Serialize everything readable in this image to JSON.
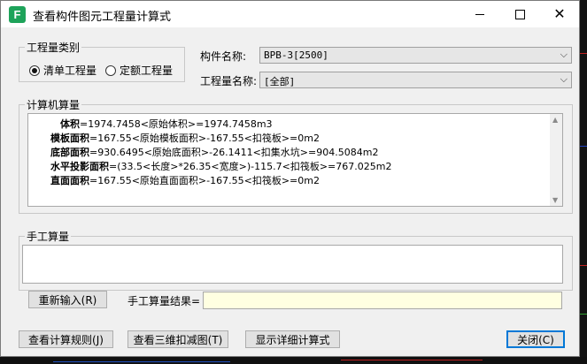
{
  "window": {
    "title": "查看构件图元工程量计算式"
  },
  "quantity_type": {
    "legend": "工程量类别",
    "options": [
      {
        "label": "清单工程量",
        "checked": true
      },
      {
        "label": "定额工程量",
        "checked": false
      }
    ]
  },
  "component": {
    "name_label": "构件名称:",
    "name_value": "BPB-3[2500]",
    "quantity_label": "工程量名称:",
    "quantity_value": "[全部]"
  },
  "computer_calc": {
    "legend": "计算机算量",
    "lines": [
      {
        "name": "体积",
        "expr": "=1974.7458<原始体积>=1974.7458m3"
      },
      {
        "name": "模板面积",
        "expr": "=167.55<原始模板面积>-167.55<扣筏板>=0m2"
      },
      {
        "name": "底部面积",
        "expr": "=930.6495<原始底面积>-26.1411<扣集水坑>=904.5084m2"
      },
      {
        "name": "水平投影面积",
        "expr": "=(33.5<长度>*26.35<宽度>)-115.7<扣筏板>=767.025m2"
      },
      {
        "name": "直面面积",
        "expr": "=167.55<原始直面面积>-167.55<扣筏板>=0m2"
      }
    ]
  },
  "manual_calc": {
    "legend": "手工算量",
    "reenter_button": "重新输入(R)",
    "result_label": "手工算量结果=",
    "result_value": ""
  },
  "footer": {
    "view_rules": "查看计算规则(J)",
    "view_3d": "查看三维扣减图(T)",
    "show_detail": "显示详细计算式",
    "close": "关闭(C)"
  },
  "colors": {
    "app_icon": "#1ea35a",
    "default_button_border": "#0078d7",
    "result_field_bg": "#ffffe1"
  }
}
